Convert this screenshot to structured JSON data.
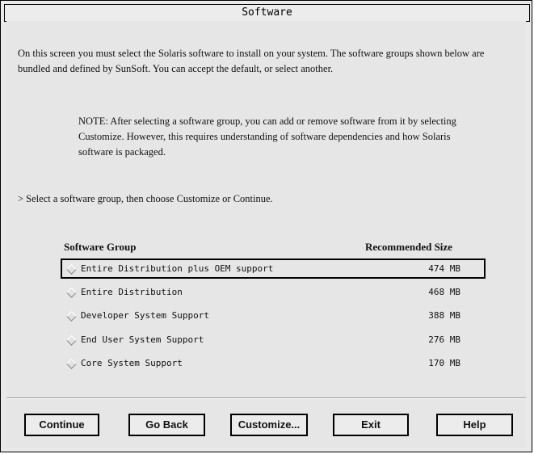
{
  "window": {
    "title": "Software"
  },
  "intro_text": "On this screen you must select the Solaris software to install on your system. The software groups shown below are bundled and defined by SunSoft. You can accept the default, or select another.",
  "note_text": "NOTE: After selecting a software group, you can add or remove software from it by selecting Customize. However, this requires understanding of software dependencies and how Solaris software is packaged.",
  "prompt_text": "> Select a software group, then choose Customize or Continue.",
  "table": {
    "headers": {
      "group": "Software Group",
      "size": "Recommended Size"
    },
    "rows": [
      {
        "label": "Entire Distribution plus OEM support",
        "size": "474 MB",
        "selected": true
      },
      {
        "label": "Entire Distribution",
        "size": "468 MB",
        "selected": false
      },
      {
        "label": "Developer System Support",
        "size": "388 MB",
        "selected": false
      },
      {
        "label": "End User System Support",
        "size": "276 MB",
        "selected": false
      },
      {
        "label": "Core System Support",
        "size": "170 MB",
        "selected": false
      }
    ]
  },
  "buttons": {
    "continue": "Continue",
    "go_back": "Go Back",
    "customize": "Customize...",
    "exit": "Exit",
    "help": "Help"
  }
}
